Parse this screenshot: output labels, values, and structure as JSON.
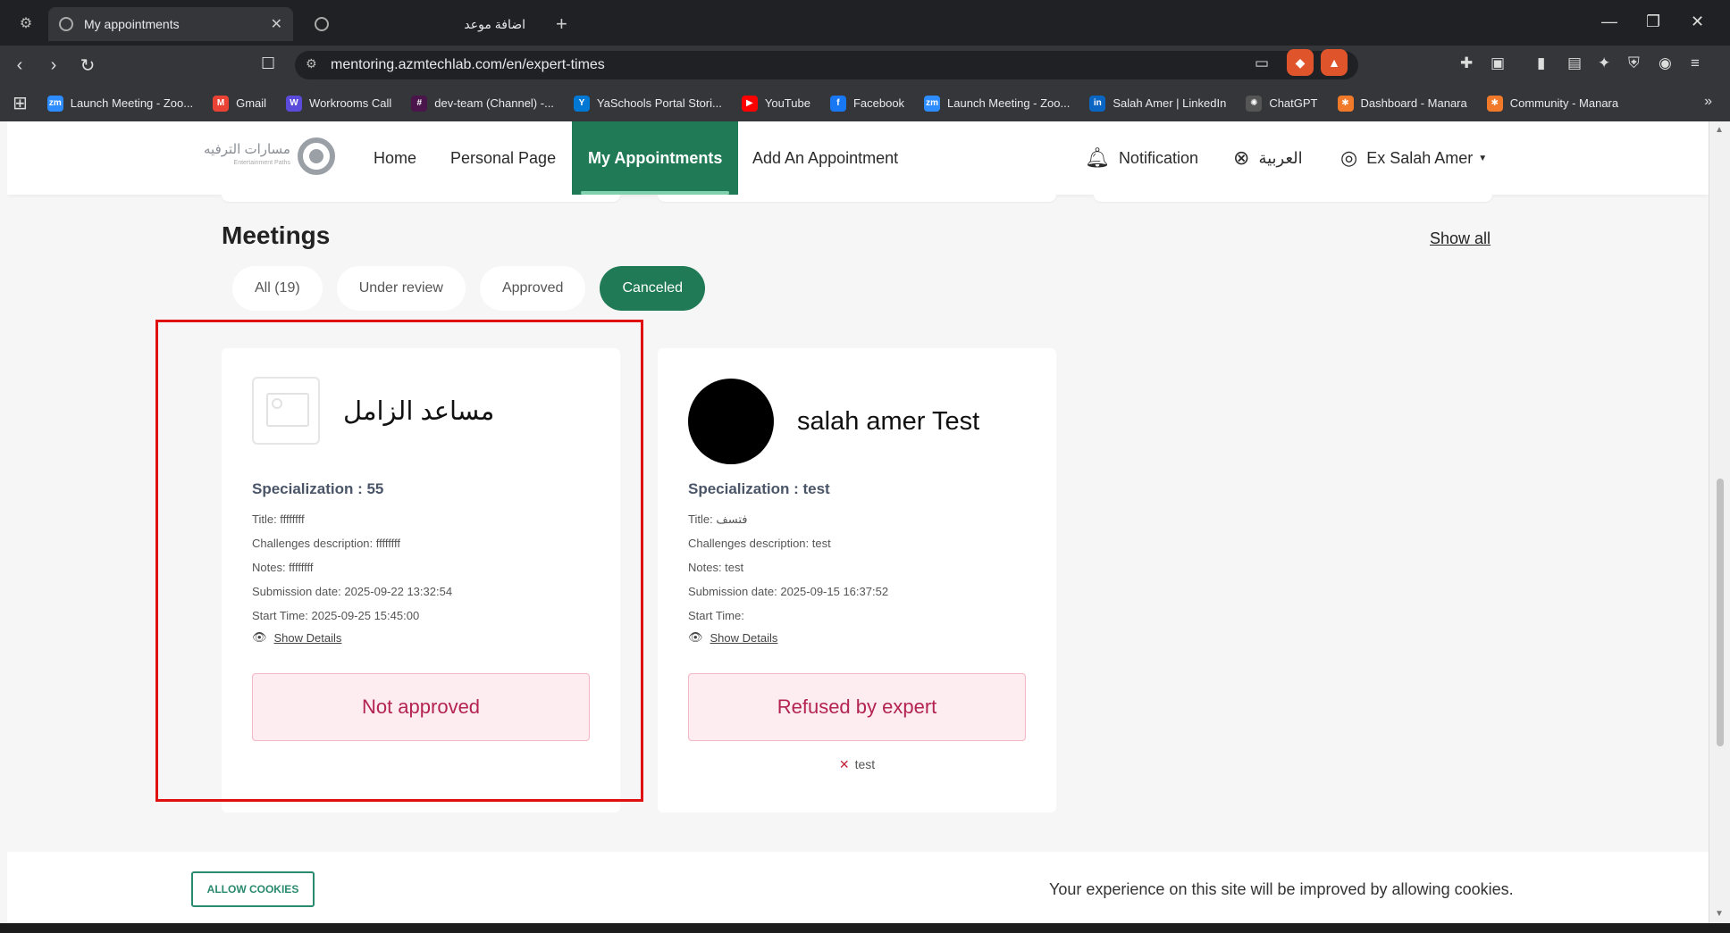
{
  "browser": {
    "active_tab_title": "My appointments",
    "inactive_tab_title": "اضافة موعد",
    "url": "mentoring.azmtechlab.com/en/expert-times",
    "bookmarks": [
      {
        "label": "Launch Meeting - Zoo...",
        "icon": "zm",
        "color": "#2d8cff"
      },
      {
        "label": "Gmail",
        "icon": "M",
        "color": "#ea4335"
      },
      {
        "label": "Workrooms Call",
        "icon": "W",
        "color": "#5b4bdb"
      },
      {
        "label": "dev-team (Channel) -...",
        "icon": "#",
        "color": "#4a154b"
      },
      {
        "label": "YaSchools Portal Stori...",
        "icon": "Y",
        "color": "#0078d4"
      },
      {
        "label": "YouTube",
        "icon": "▶",
        "color": "#ff0000"
      },
      {
        "label": "Facebook",
        "icon": "f",
        "color": "#1877f2"
      },
      {
        "label": "Launch Meeting - Zoo...",
        "icon": "zm",
        "color": "#2d8cff"
      },
      {
        "label": "Salah Amer | LinkedIn",
        "icon": "in",
        "color": "#0a66c2"
      },
      {
        "label": "ChatGPT",
        "icon": "✺",
        "color": "#555555"
      },
      {
        "label": "Dashboard - Manara",
        "icon": "✱",
        "color": "#f07a2a"
      },
      {
        "label": "Community - Manara",
        "icon": "✱",
        "color": "#f07a2a"
      }
    ]
  },
  "nav": {
    "logo_text": "مسارات الترفيه",
    "logo_sub": "Entertainment Paths",
    "home": "Home",
    "personal_page": "Personal Page",
    "my_appointments": "My Appointments",
    "add_appointment": "Add An Appointment",
    "notification": "Notification",
    "language": "العربية",
    "user": "Ex Salah Amer"
  },
  "meetings": {
    "title": "Meetings",
    "show_all": "Show all",
    "filters": [
      "All (19)",
      "Under review",
      "Approved",
      "Canceled"
    ]
  },
  "cards": [
    {
      "name": "مساعد الزامل",
      "specialization": "Specialization : 55",
      "title": "Title: ffffffff",
      "challenges": "Challenges description: ffffffff",
      "notes": "Notes: ffffffff",
      "submission": "Submission date: 2025-09-22 13:32:54",
      "start": "Start Time: 2025-09-25 15:45:00",
      "show_details": "Show Details",
      "status": "Not approved"
    },
    {
      "name": "salah amer Test",
      "specialization": "Specialization : test",
      "title": "Title: فتسف",
      "challenges": "Challenges description: test",
      "notes": "Notes: test",
      "submission": "Submission date: 2025-09-15 16:37:52",
      "start": "Start Time:",
      "show_details": "Show Details",
      "status": "Refused by expert",
      "reason": "test"
    }
  ],
  "cookies": {
    "button": "ALLOW COOKIES",
    "message": "Your experience on this site will be improved by allowing cookies."
  }
}
